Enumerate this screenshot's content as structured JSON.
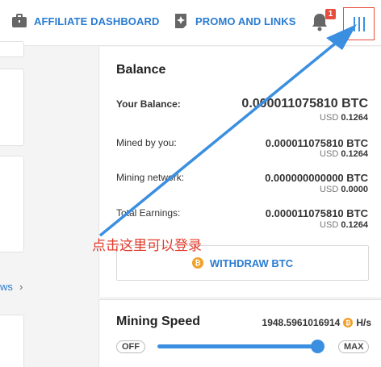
{
  "topbar": {
    "affiliate_label": "AFFILIATE DASHBOARD",
    "promo_label": "PROMO AND LINKS",
    "notifications_count": "1",
    "icons": {
      "affiliate": "briefcase-icon",
      "promo": "sparkle-tag-icon",
      "bell": "bell-icon",
      "menu": "hamburger-vertical-icon"
    }
  },
  "left": {
    "link_fragment": "ws"
  },
  "balance": {
    "title": "Balance",
    "rows": [
      {
        "label": "Your Balance:",
        "btc": "0.000011075810 BTC",
        "usd_prefix": "USD",
        "usd": "0.1264"
      },
      {
        "label": "Mined by you:",
        "btc": "0.000011075810 BTC",
        "usd_prefix": "USD",
        "usd": "0.1264"
      },
      {
        "label": "Mining network:",
        "btc": "0.000000000000 BTC",
        "usd_prefix": "USD",
        "usd": "0.0000"
      },
      {
        "label": "Total Earnings:",
        "btc": "0.000011075810 BTC",
        "usd_prefix": "USD",
        "usd": "0.1264"
      }
    ],
    "withdraw_label": "WITHDRAW BTC",
    "coin_symbol": "₿"
  },
  "mining": {
    "title": "Mining Speed",
    "value": "1948.5961016914",
    "unit": "H/s",
    "off_label": "OFF",
    "max_label": "MAX",
    "slider_level": 1.0
  },
  "annotation": {
    "text": "点击这里可以登录",
    "color": "#e23b2b",
    "arrow_color": "#3b8fe0"
  }
}
